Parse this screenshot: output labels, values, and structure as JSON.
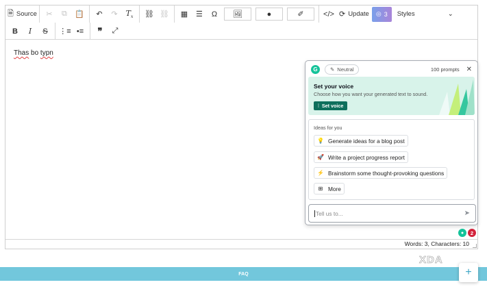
{
  "toolbar": {
    "source_label": "Source",
    "update_label": "Update",
    "notification_count": "3",
    "styles_label": "Styles"
  },
  "editor": {
    "words": [
      "Thas",
      "bo",
      "typn"
    ]
  },
  "status": {
    "text": "Words: 3, Characters: 10"
  },
  "grammarly": {
    "tone_label": "Neutral",
    "prompts_count": "100 prompts",
    "voice": {
      "title": "Set your voice",
      "desc": "Choose how you want your generated text to sound.",
      "button": "Set voice"
    },
    "ideas_header": "Ideas for you",
    "ideas": [
      {
        "icon": "lightbulb-icon",
        "label": "Generate ideas for a blog post"
      },
      {
        "icon": "rocket-icon",
        "label": "Write a project progress report"
      },
      {
        "icon": "lightning-icon",
        "label": "Brainstorm some thought-provoking questions"
      },
      {
        "icon": "grid-plus-icon",
        "label": "More"
      }
    ],
    "input_placeholder": "Tell us to...",
    "floating_count": "2"
  },
  "footer": {
    "text": "FAQ"
  },
  "watermark": "XDA",
  "colors": {
    "grammarly_green": "#15c39a",
    "voice_bg": "#d8f3ea",
    "voice_button": "#0e6f5c",
    "footer_bg": "#72c7dc",
    "count_red": "#d3233b"
  }
}
